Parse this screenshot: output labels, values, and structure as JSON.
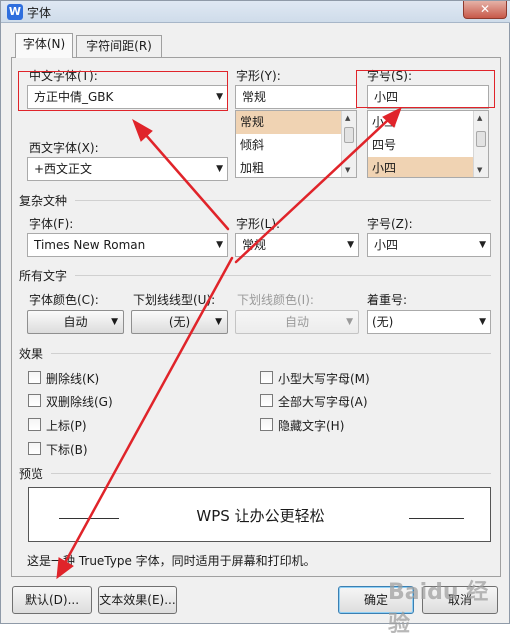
{
  "window": {
    "title": "字体",
    "app_icon": "W",
    "close_label": "✕"
  },
  "tabs": [
    {
      "label": "字体(N)"
    },
    {
      "label": "字符间距(R)"
    }
  ],
  "chinese_font": {
    "label": "中文字体(T):",
    "value": "方正中倩_GBK"
  },
  "style": {
    "label": "字形(Y):",
    "value": "常规",
    "options": [
      "常规",
      "倾斜",
      "加粗"
    ]
  },
  "size": {
    "label": "字号(S):",
    "value": "小四",
    "options": [
      "小三",
      "四号",
      "小四"
    ]
  },
  "western_font": {
    "label": "西文字体(X):",
    "value": "+西文正文"
  },
  "complex": {
    "heading": "复杂文种",
    "font_label": "字体(F):",
    "font_value": "Times New Roman",
    "style_label": "字形(L):",
    "style_value": "常规",
    "size_label": "字号(Z):",
    "size_value": "小四"
  },
  "all_text": {
    "heading": "所有文字",
    "font_color_label": "字体颜色(C):",
    "font_color_value": "自动",
    "underline_style_label": "下划线线型(U):",
    "underline_style_value": "(无)",
    "underline_color_label": "下划线颜色(I):",
    "underline_color_value": "自动",
    "emphasis_label": "着重号:",
    "emphasis_value": "(无)"
  },
  "effects": {
    "heading": "效果",
    "items": [
      "删除线(K)",
      "双删除线(G)",
      "上标(P)",
      "下标(B)",
      "小型大写字母(M)",
      "全部大写字母(A)",
      "隐藏文字(H)"
    ]
  },
  "preview": {
    "heading": "预览",
    "sample": "WPS 让办公更轻松"
  },
  "note": "这是一种 TrueType 字体，同时适用于屏幕和打印机。",
  "buttons": {
    "default": "默认(D)...",
    "text_effects": "文本效果(E)...",
    "ok": "确定",
    "cancel": "取消"
  },
  "watermark": "Baidu 经验",
  "colors": {
    "annotation": "#e0242a",
    "selection": "#f0d3b3"
  }
}
